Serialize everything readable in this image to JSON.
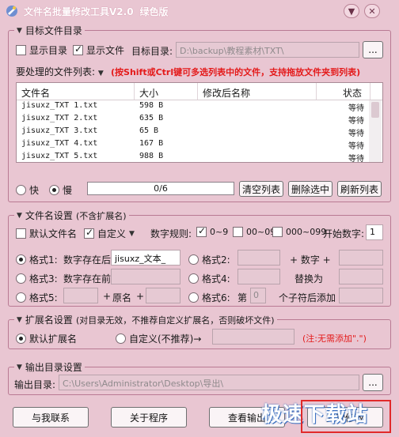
{
  "window": {
    "title": "文件名批量修改工具V2.0",
    "edition": "绿色版",
    "min_label": "▼",
    "close_label": "✕"
  },
  "target_group": {
    "title": "目标文件目录",
    "show_dirs_label": "显示目录",
    "show_dirs_checked": false,
    "show_files_label": "显示文件",
    "show_files_checked": true,
    "target_dir_label": "目标目录:",
    "target_dir_value": "D:\\backup\\教程素材\\TXT\\",
    "browse_label": "...",
    "list_label": "要处理的文件列表:",
    "hint": "(按Shift或Ctrl键可多选列表中的文件，支持拖放文件夹到列表)",
    "columns": [
      "文件名",
      "大小",
      "修改后名称",
      "状态"
    ],
    "rows": [
      {
        "name": "jisuxz_TXT 1.txt",
        "size": "598 B",
        "new_name": "",
        "status": "等待"
      },
      {
        "name": "jisuxz_TXT 2.txt",
        "size": "635 B",
        "new_name": "",
        "status": "等待"
      },
      {
        "name": "jisuxz_TXT 3.txt",
        "size": "65 B",
        "new_name": "",
        "status": "等待"
      },
      {
        "name": "jisuxz_TXT 4.txt",
        "size": "167 B",
        "new_name": "",
        "status": "等待"
      },
      {
        "name": "jisuxz_TXT 5.txt",
        "size": "988 B",
        "new_name": "",
        "status": "等待"
      }
    ],
    "speed_fast": "快",
    "speed_slow": "慢",
    "progress_text": "0/6",
    "progress_fraction": 0,
    "clear_list": "清空列表",
    "delete_selected": "删除选中",
    "refresh_list": "刷新列表"
  },
  "name_group": {
    "title": "文件名设置",
    "title_note": "(不含扩展名)",
    "default_name": "默认文件名",
    "custom": "自定义",
    "digit_rule": "数字规则:",
    "rule_a": "0~9",
    "rule_b": "00~09",
    "rule_c": "000~099",
    "start_num_label": "开始数字:",
    "start_num": "1",
    "fmt1": "格式1:",
    "fmt1_mid": "数字存在后:",
    "fmt1_value": "jisuxz_文本_",
    "fmt2": "格式2:",
    "fmt2_mid": "+ 数字 +",
    "fmt3": "格式3:",
    "fmt3_mid": "数字存在前:",
    "fmt4": "格式4:",
    "fmt4_mid": "替换为",
    "fmt5": "格式5:",
    "fmt5_plus1": "+",
    "fmt5_mid": "原名",
    "fmt5_plus2": "+",
    "fmt6": "格式6:",
    "fmt6_pre": "第",
    "fmt6_num": "0",
    "fmt6_post": "个子符后添加"
  },
  "ext_group": {
    "title": "扩展名设置",
    "title_note": "(对目录无效，不推荐自定义扩展名，否则破坏文件)",
    "default_ext": "默认扩展名",
    "custom_ext": "自定义(不推荐)→",
    "note": "(注:无需添加\".\")"
  },
  "output_group": {
    "title": "输出目录设置",
    "out_label": "输出目录:",
    "out_value": "C:\\Users\\Administrator\\Desktop\\导出\\",
    "browse_label": "..."
  },
  "footer": {
    "contact": "与我联系",
    "about": "关于程序",
    "view_output": "查看输出",
    "start": "复制修改"
  },
  "watermark": "极速下载站"
}
